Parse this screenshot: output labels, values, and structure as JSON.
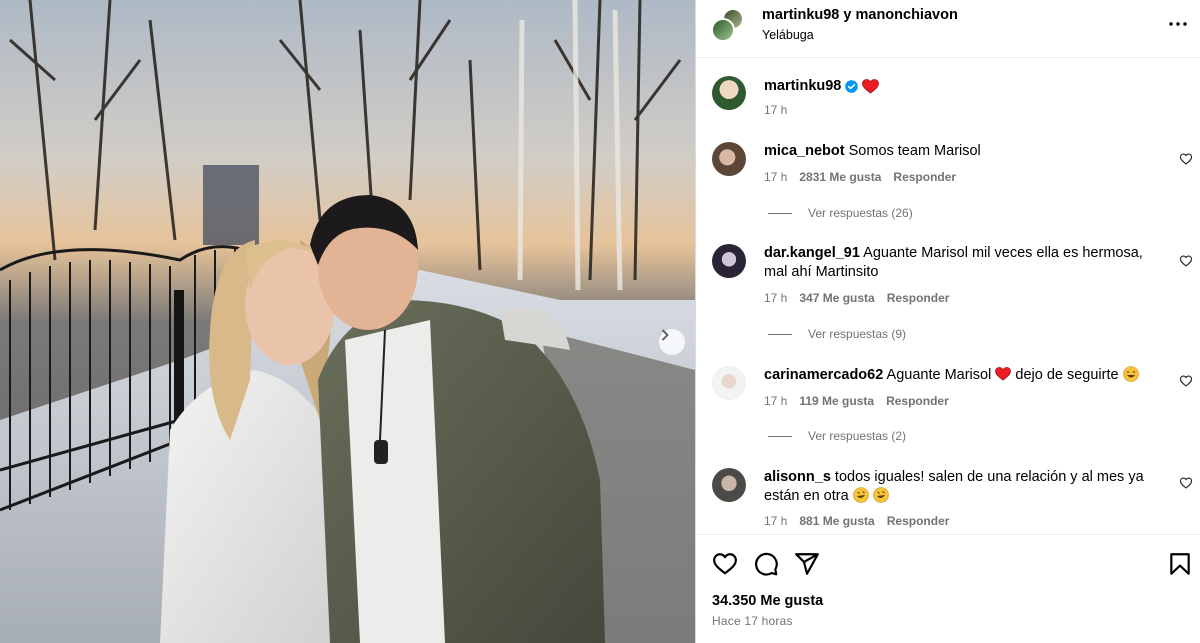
{
  "header": {
    "title": "martinku98 y manonchiavon",
    "location": "Yelábuga",
    "more_icon": "more-horizontal-icon"
  },
  "caption": {
    "username": "martinku98",
    "verified_icon": "verified-badge-icon",
    "emoji": "red-heart",
    "time": "17 h"
  },
  "comments": [
    {
      "username": "mica_nebot",
      "text": "Somos team Marisol",
      "time": "17 h",
      "likes": "2831 Me gusta",
      "reply_label": "Responder",
      "view_replies": "Ver respuestas (26)"
    },
    {
      "username": "dar.kangel_91",
      "text": "Aguante Marisol mil veces ella es hermosa, mal ahí Martinsito",
      "time": "17 h",
      "likes": "347 Me gusta",
      "reply_label": "Responder",
      "view_replies": "Ver respuestas (9)"
    },
    {
      "username": "carinamercado62",
      "text_before": "Aguante Marisol",
      "text_after": "dejo de seguirte",
      "time": "17 h",
      "likes": "119 Me gusta",
      "reply_label": "Responder",
      "view_replies": "Ver respuestas (2)"
    },
    {
      "username": "alisonn_s",
      "text": "todos iguales! salen de una relación y al mes ya están en otra",
      "time": "17 h",
      "likes": "881 Me gusta",
      "reply_label": "Responder"
    }
  ],
  "footer": {
    "likes": "34.350 Me gusta",
    "posted": "Hace 17 horas"
  },
  "colors": {
    "verified": "#0095f6",
    "heart_red": "#ed1c24",
    "secondary_text": "#737373"
  }
}
